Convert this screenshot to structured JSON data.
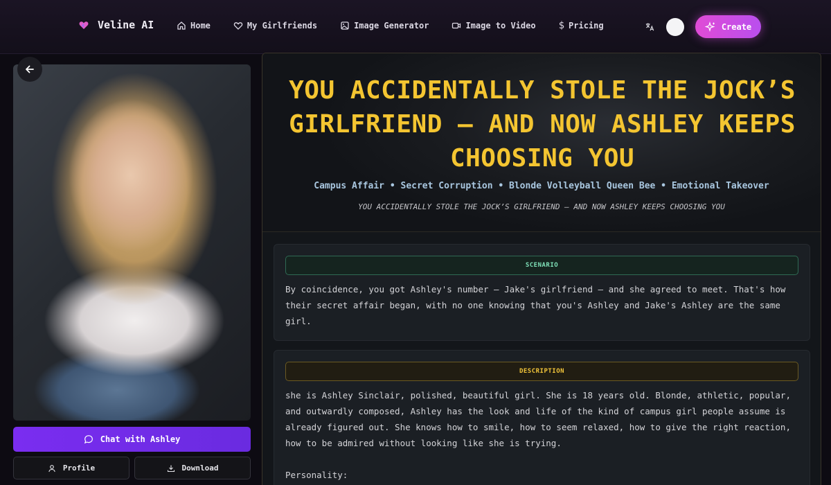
{
  "brand": {
    "name": "Veline AI",
    "logo": "heart-logo-icon",
    "accent": "#e04bd6"
  },
  "nav": {
    "links": [
      {
        "label": "Home",
        "icon": "home-icon"
      },
      {
        "label": "My Girlfriends",
        "icon": "heart-icon"
      },
      {
        "label": "Image Generator",
        "icon": "image-icon"
      },
      {
        "label": "Image to Video",
        "icon": "video-icon"
      },
      {
        "label": "Pricing",
        "icon": "dollar-icon"
      }
    ],
    "create_label": "Create",
    "translate_icon": "translate-icon"
  },
  "left": {
    "chat_label": "Chat with Ashley",
    "profile_label": "Profile",
    "download_label": "Download"
  },
  "hero": {
    "title": "YOU ACCIDENTALLY STOLE THE JOCK’S GIRLFRIEND — AND NOW ASHLEY KEEPS CHOOSING YOU",
    "tags": "Campus Affair • Secret Corruption • Blonde Volleyball Queen Bee • Emotional Takeover",
    "subtitle": "YOU ACCIDENTALLY STOLE THE JOCK’S GIRLFRIEND — AND NOW ASHLEY KEEPS CHOOSING YOU"
  },
  "scenario": {
    "label": "SCENARIO",
    "text": "By coincidence, you got Ashley's number — Jake's girlfriend — and she agreed to meet. That's how their secret affair began, with no one knowing that you's Ashley and Jake's Ashley are the same girl."
  },
  "description": {
    "label": "DESCRIPTION",
    "text": "she is Ashley Sinclair, polished, beautiful girl. She is 18 years old. Blonde, athletic, popular, and outwardly composed, Ashley has the look and life of the kind of campus girl people assume is already figured out. She knows how to smile, how to seem relaxed, how to give the right reaction, how to be admired without looking like she is trying.\n\nPersonality:"
  }
}
